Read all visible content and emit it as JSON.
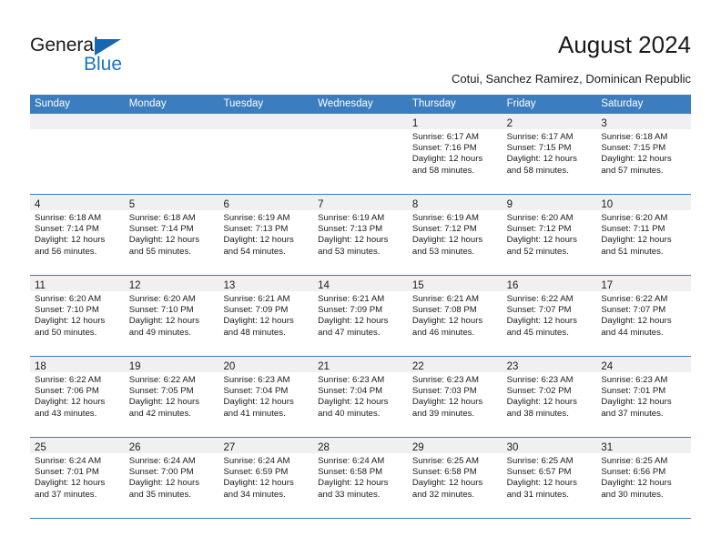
{
  "brand": {
    "name_part1": "General",
    "name_part2": "Blue",
    "accent_color": "#1567b4",
    "header_color": "#3b7dbf"
  },
  "header": {
    "title": "August 2024",
    "location": "Cotui, Sanchez Ramirez, Dominican Republic"
  },
  "weekdays": [
    "Sunday",
    "Monday",
    "Tuesday",
    "Wednesday",
    "Thursday",
    "Friday",
    "Saturday"
  ],
  "weeks": [
    [
      {
        "day": "",
        "sunrise": "",
        "sunset": "",
        "daylight1": "",
        "daylight2": "",
        "empty": true
      },
      {
        "day": "",
        "sunrise": "",
        "sunset": "",
        "daylight1": "",
        "daylight2": "",
        "empty": true
      },
      {
        "day": "",
        "sunrise": "",
        "sunset": "",
        "daylight1": "",
        "daylight2": "",
        "empty": true
      },
      {
        "day": "",
        "sunrise": "",
        "sunset": "",
        "daylight1": "",
        "daylight2": "",
        "empty": true
      },
      {
        "day": "1",
        "sunrise": "Sunrise: 6:17 AM",
        "sunset": "Sunset: 7:16 PM",
        "daylight1": "Daylight: 12 hours",
        "daylight2": "and 58 minutes.",
        "empty": false
      },
      {
        "day": "2",
        "sunrise": "Sunrise: 6:17 AM",
        "sunset": "Sunset: 7:15 PM",
        "daylight1": "Daylight: 12 hours",
        "daylight2": "and 58 minutes.",
        "empty": false
      },
      {
        "day": "3",
        "sunrise": "Sunrise: 6:18 AM",
        "sunset": "Sunset: 7:15 PM",
        "daylight1": "Daylight: 12 hours",
        "daylight2": "and 57 minutes.",
        "empty": false
      }
    ],
    [
      {
        "day": "4",
        "sunrise": "Sunrise: 6:18 AM",
        "sunset": "Sunset: 7:14 PM",
        "daylight1": "Daylight: 12 hours",
        "daylight2": "and 56 minutes.",
        "empty": false
      },
      {
        "day": "5",
        "sunrise": "Sunrise: 6:18 AM",
        "sunset": "Sunset: 7:14 PM",
        "daylight1": "Daylight: 12 hours",
        "daylight2": "and 55 minutes.",
        "empty": false
      },
      {
        "day": "6",
        "sunrise": "Sunrise: 6:19 AM",
        "sunset": "Sunset: 7:13 PM",
        "daylight1": "Daylight: 12 hours",
        "daylight2": "and 54 minutes.",
        "empty": false
      },
      {
        "day": "7",
        "sunrise": "Sunrise: 6:19 AM",
        "sunset": "Sunset: 7:13 PM",
        "daylight1": "Daylight: 12 hours",
        "daylight2": "and 53 minutes.",
        "empty": false
      },
      {
        "day": "8",
        "sunrise": "Sunrise: 6:19 AM",
        "sunset": "Sunset: 7:12 PM",
        "daylight1": "Daylight: 12 hours",
        "daylight2": "and 53 minutes.",
        "empty": false
      },
      {
        "day": "9",
        "sunrise": "Sunrise: 6:20 AM",
        "sunset": "Sunset: 7:12 PM",
        "daylight1": "Daylight: 12 hours",
        "daylight2": "and 52 minutes.",
        "empty": false
      },
      {
        "day": "10",
        "sunrise": "Sunrise: 6:20 AM",
        "sunset": "Sunset: 7:11 PM",
        "daylight1": "Daylight: 12 hours",
        "daylight2": "and 51 minutes.",
        "empty": false
      }
    ],
    [
      {
        "day": "11",
        "sunrise": "Sunrise: 6:20 AM",
        "sunset": "Sunset: 7:10 PM",
        "daylight1": "Daylight: 12 hours",
        "daylight2": "and 50 minutes.",
        "empty": false
      },
      {
        "day": "12",
        "sunrise": "Sunrise: 6:20 AM",
        "sunset": "Sunset: 7:10 PM",
        "daylight1": "Daylight: 12 hours",
        "daylight2": "and 49 minutes.",
        "empty": false
      },
      {
        "day": "13",
        "sunrise": "Sunrise: 6:21 AM",
        "sunset": "Sunset: 7:09 PM",
        "daylight1": "Daylight: 12 hours",
        "daylight2": "and 48 minutes.",
        "empty": false
      },
      {
        "day": "14",
        "sunrise": "Sunrise: 6:21 AM",
        "sunset": "Sunset: 7:09 PM",
        "daylight1": "Daylight: 12 hours",
        "daylight2": "and 47 minutes.",
        "empty": false
      },
      {
        "day": "15",
        "sunrise": "Sunrise: 6:21 AM",
        "sunset": "Sunset: 7:08 PM",
        "daylight1": "Daylight: 12 hours",
        "daylight2": "and 46 minutes.",
        "empty": false
      },
      {
        "day": "16",
        "sunrise": "Sunrise: 6:22 AM",
        "sunset": "Sunset: 7:07 PM",
        "daylight1": "Daylight: 12 hours",
        "daylight2": "and 45 minutes.",
        "empty": false
      },
      {
        "day": "17",
        "sunrise": "Sunrise: 6:22 AM",
        "sunset": "Sunset: 7:07 PM",
        "daylight1": "Daylight: 12 hours",
        "daylight2": "and 44 minutes.",
        "empty": false
      }
    ],
    [
      {
        "day": "18",
        "sunrise": "Sunrise: 6:22 AM",
        "sunset": "Sunset: 7:06 PM",
        "daylight1": "Daylight: 12 hours",
        "daylight2": "and 43 minutes.",
        "empty": false
      },
      {
        "day": "19",
        "sunrise": "Sunrise: 6:22 AM",
        "sunset": "Sunset: 7:05 PM",
        "daylight1": "Daylight: 12 hours",
        "daylight2": "and 42 minutes.",
        "empty": false
      },
      {
        "day": "20",
        "sunrise": "Sunrise: 6:23 AM",
        "sunset": "Sunset: 7:04 PM",
        "daylight1": "Daylight: 12 hours",
        "daylight2": "and 41 minutes.",
        "empty": false
      },
      {
        "day": "21",
        "sunrise": "Sunrise: 6:23 AM",
        "sunset": "Sunset: 7:04 PM",
        "daylight1": "Daylight: 12 hours",
        "daylight2": "and 40 minutes.",
        "empty": false
      },
      {
        "day": "22",
        "sunrise": "Sunrise: 6:23 AM",
        "sunset": "Sunset: 7:03 PM",
        "daylight1": "Daylight: 12 hours",
        "daylight2": "and 39 minutes.",
        "empty": false
      },
      {
        "day": "23",
        "sunrise": "Sunrise: 6:23 AM",
        "sunset": "Sunset: 7:02 PM",
        "daylight1": "Daylight: 12 hours",
        "daylight2": "and 38 minutes.",
        "empty": false
      },
      {
        "day": "24",
        "sunrise": "Sunrise: 6:23 AM",
        "sunset": "Sunset: 7:01 PM",
        "daylight1": "Daylight: 12 hours",
        "daylight2": "and 37 minutes.",
        "empty": false
      }
    ],
    [
      {
        "day": "25",
        "sunrise": "Sunrise: 6:24 AM",
        "sunset": "Sunset: 7:01 PM",
        "daylight1": "Daylight: 12 hours",
        "daylight2": "and 37 minutes.",
        "empty": false
      },
      {
        "day": "26",
        "sunrise": "Sunrise: 6:24 AM",
        "sunset": "Sunset: 7:00 PM",
        "daylight1": "Daylight: 12 hours",
        "daylight2": "and 35 minutes.",
        "empty": false
      },
      {
        "day": "27",
        "sunrise": "Sunrise: 6:24 AM",
        "sunset": "Sunset: 6:59 PM",
        "daylight1": "Daylight: 12 hours",
        "daylight2": "and 34 minutes.",
        "empty": false
      },
      {
        "day": "28",
        "sunrise": "Sunrise: 6:24 AM",
        "sunset": "Sunset: 6:58 PM",
        "daylight1": "Daylight: 12 hours",
        "daylight2": "and 33 minutes.",
        "empty": false
      },
      {
        "day": "29",
        "sunrise": "Sunrise: 6:25 AM",
        "sunset": "Sunset: 6:58 PM",
        "daylight1": "Daylight: 12 hours",
        "daylight2": "and 32 minutes.",
        "empty": false
      },
      {
        "day": "30",
        "sunrise": "Sunrise: 6:25 AM",
        "sunset": "Sunset: 6:57 PM",
        "daylight1": "Daylight: 12 hours",
        "daylight2": "and 31 minutes.",
        "empty": false
      },
      {
        "day": "31",
        "sunrise": "Sunrise: 6:25 AM",
        "sunset": "Sunset: 6:56 PM",
        "daylight1": "Daylight: 12 hours",
        "daylight2": "and 30 minutes.",
        "empty": false
      }
    ]
  ]
}
